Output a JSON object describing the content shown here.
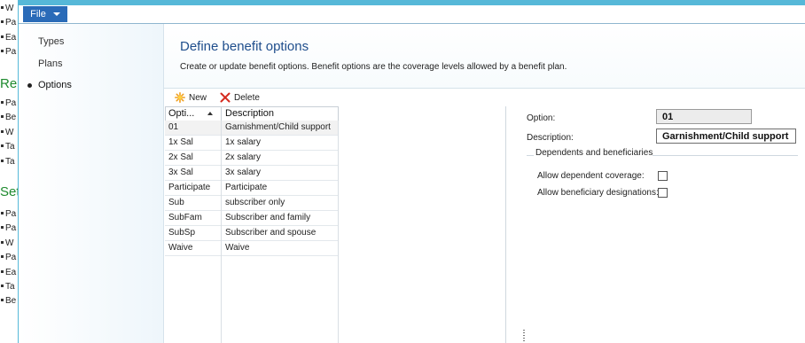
{
  "background_window": {
    "lines_top": [
      "W",
      "Pa",
      "Ea",
      "Pa"
    ],
    "heading1": "Rep",
    "lines_mid": [
      "Pa",
      "Be",
      "W",
      "Ta",
      "Ta"
    ],
    "heading2": "Set",
    "lines_bottom": [
      "Pa",
      "Pa",
      "W",
      "Pa",
      "Ea",
      "Ta",
      "Be"
    ]
  },
  "menu": {
    "file_label": "File"
  },
  "nav": {
    "items": [
      {
        "label": "Types"
      },
      {
        "label": "Plans"
      },
      {
        "label": "Options"
      }
    ]
  },
  "header": {
    "title": "Define benefit options",
    "description": "Create or update benefit options. Benefit options are the coverage levels allowed by a benefit plan."
  },
  "toolbar": {
    "new_label": "New",
    "delete_label": "Delete"
  },
  "grid": {
    "columns": [
      "Opti...",
      "Description"
    ],
    "rows": [
      {
        "option": "01",
        "description": "Garnishment/Child support"
      },
      {
        "option": "1x Sal",
        "description": "1x salary"
      },
      {
        "option": "2x Sal",
        "description": "2x salary"
      },
      {
        "option": "3x Sal",
        "description": "3x salary"
      },
      {
        "option": "Participate",
        "description": "Participate"
      },
      {
        "option": "Sub",
        "description": "subscriber only"
      },
      {
        "option": "SubFam",
        "description": "Subscriber and family"
      },
      {
        "option": "SubSp",
        "description": "Subscriber and spouse"
      },
      {
        "option": "Waive",
        "description": "Waive"
      }
    ]
  },
  "detail": {
    "option_label": "Option:",
    "option_value": "01",
    "description_label": "Description:",
    "description_value": "Garnishment/Child support",
    "group_title": "Dependents and beneficiaries",
    "allow_dependent_label": "Allow dependent coverage:",
    "allow_beneficiary_label": "Allow beneficiary designations:"
  },
  "colors": {
    "title_blue": "#1f4e8c",
    "file_button": "#2a6bb8",
    "titlebar": "#56b8d8",
    "bg_heading_green": "#1e8a2e"
  }
}
